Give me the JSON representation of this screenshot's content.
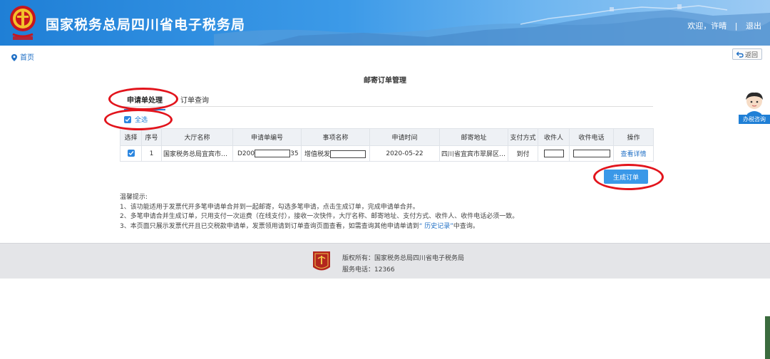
{
  "header": {
    "site_title": "国家税务总局四川省电子税务局",
    "welcome": "欢迎，许晴",
    "separator": "|",
    "logout": "退出",
    "emblem_icon": "tax-emblem-icon"
  },
  "breadcrumb": {
    "home": "首页"
  },
  "back_button": "返回",
  "page_title": "邮寄订单管理",
  "tabs": [
    {
      "label": "申请单处理",
      "active": true
    },
    {
      "label": "订单查询",
      "active": false
    }
  ],
  "select_all": {
    "label": "全选",
    "checked": true
  },
  "table": {
    "headers": [
      "选择",
      "序号",
      "大厅名称",
      "申请单编号",
      "事项名称",
      "申请时间",
      "邮寄地址",
      "支付方式",
      "收件人",
      "收件电话",
      "操作"
    ],
    "rows": [
      {
        "checked": true,
        "index": "1",
        "hall": "国家税务总局宜宾市翠...",
        "app_no_prefix": "D200",
        "app_no_suffix": "35",
        "item_prefix": "增值税发",
        "time": "2020-05-22",
        "address": "四川省宜宾市翠屏区翠...",
        "payment": "到付",
        "action": "查看详情"
      }
    ]
  },
  "generate_button": "生成订单",
  "notes": {
    "title": "温馨提示:",
    "line1": "1、该功能适用于发票代开多笔申请单合并到一起邮寄，勾选多笔申请，点击生成订单，完成申请单合并。",
    "line2": "2、多笔申请合并生成订单，只用支付一次运费（在线支付），接收一次快件，大厅名称、邮寄地址、支付方式、收件人、收件电话必须一致。",
    "line3_prefix": "3、本页面只展示发票代开且已交税款申请单，发票领用请到订单查询页面查看，如需查询其他申请单请到",
    "line3_link": "“ 历史记录”",
    "line3_suffix": "中查询。"
  },
  "side": {
    "consult_label": "办税咨询"
  },
  "footer": {
    "copyright": "版权所有：国家税务总局四川省电子税务局",
    "phone": "服务电话：12366"
  },
  "colors": {
    "accent": "#1f7fd6",
    "annotation": "#e2141c",
    "button": "#3a98e8"
  }
}
